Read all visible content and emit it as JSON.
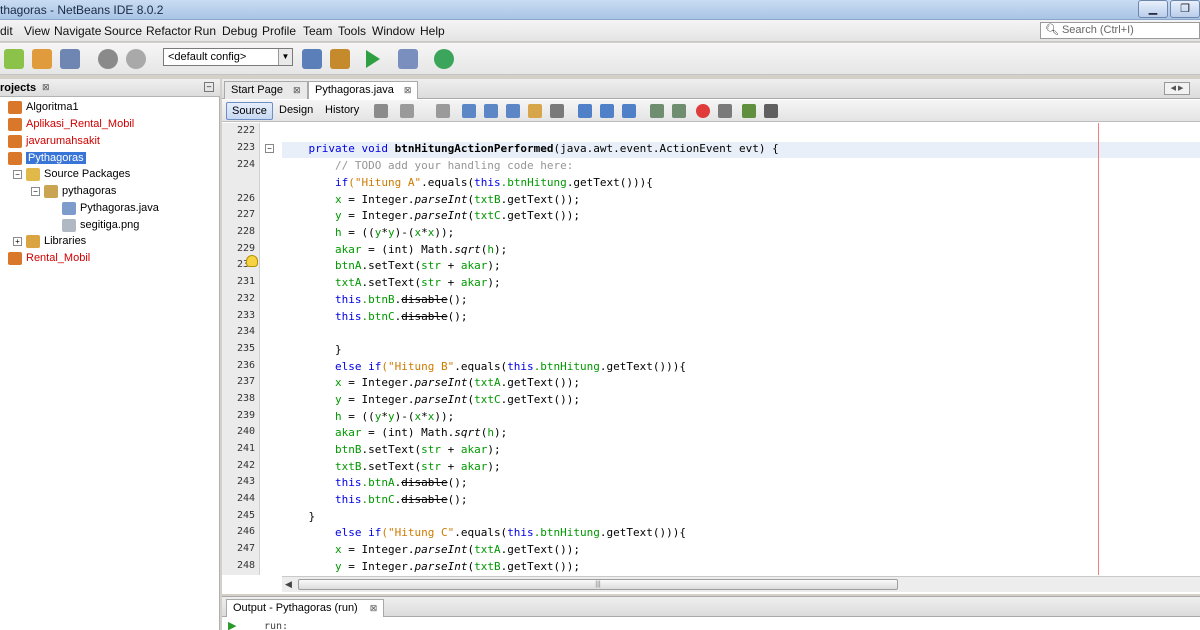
{
  "window": {
    "title": "thagoras - NetBeans IDE 8.0.2",
    "min_glyph": "▁",
    "max_glyph": "❐"
  },
  "menu": [
    "dit",
    "View",
    "Navigate",
    "Source",
    "Refactor",
    "Run",
    "Debug",
    "Profile",
    "Team",
    "Tools",
    "Window",
    "Help"
  ],
  "search": {
    "placeholder": "Search (Ctrl+I)",
    "icon": "magnifier-icon"
  },
  "toolbar": {
    "config": "<default config>",
    "config_arrow": "▼"
  },
  "projects": {
    "title": "rojects",
    "close_glyph": "⊠",
    "minimize_glyph": "–",
    "items": [
      {
        "label": "Algoritma1",
        "color": "normal"
      },
      {
        "label": "Aplikasi_Rental_Mobil",
        "color": "red"
      },
      {
        "label": "javarumahsakit",
        "color": "red"
      },
      {
        "label": "Pythagoras",
        "color": "selected"
      },
      {
        "label": "Source Packages",
        "color": "normal"
      },
      {
        "label": "pythagoras",
        "color": "normal"
      },
      {
        "label": "Pythagoras.java",
        "color": "normal"
      },
      {
        "label": "segitiga.png",
        "color": "normal"
      },
      {
        "label": "Libraries",
        "color": "normal"
      },
      {
        "label": "Rental_Mobil",
        "color": "red"
      }
    ]
  },
  "editor": {
    "tabs": [
      {
        "label": "Start Page",
        "close": "⊠"
      },
      {
        "label": "Pythagoras.java",
        "close": "⊠"
      }
    ],
    "nav_arrows": "◀ ▶",
    "views": [
      "Source",
      "Design",
      "History"
    ],
    "line_numbers": [
      "222",
      "223",
      "224",
      "",
      "226",
      "227",
      "228",
      "229",
      "230",
      "231",
      "232",
      "233",
      "234",
      "235",
      "236",
      "237",
      "238",
      "239",
      "240",
      "241",
      "242",
      "243",
      "244",
      "245",
      "246",
      "247",
      "248"
    ],
    "fold_glyph": "−",
    "code": {
      "l223": {
        "a": "    ",
        "kw1": "private void ",
        "name": "btnHitungActionPerformed",
        "rest": "(java.awt.event.ActionEvent evt) {"
      },
      "l224": {
        "cm": "        // TODO add your handling code here:"
      },
      "l225": {
        "kw": "        if",
        "str": "(\"Hitung A\"",
        "rest": ".equals(",
        "kw2": "this",
        "field": ".btnHitung",
        "tail": ".getText())){"
      },
      "l226": {
        "field": "        x",
        "a": " = Integer.",
        "it": "parseInt",
        "b": "(",
        "f2": "txtB",
        "c": ".getText());"
      },
      "l227": {
        "field": "        y",
        "a": " = Integer.",
        "it": "parseInt",
        "b": "(",
        "f2": "txtC",
        "c": ".getText());"
      },
      "l228": {
        "field": "        h",
        "a": " = ((",
        "f2": "y",
        "b": "*",
        "f3": "y",
        "c": ")-(",
        "f4": "x",
        "d": "*",
        "f5": "x",
        "e": "));"
      },
      "l229": {
        "field": "        akar",
        "a": " = (int) Math.",
        "it": "sqrt",
        "b": "(",
        "f2": "h",
        "c": ");"
      },
      "l230": {
        "field": "        btnA",
        "a": ".setText(",
        "f2": "str",
        "b": " + ",
        "f3": "akar",
        "c": ");"
      },
      "l231": {
        "field": "        txtA",
        "a": ".setText(",
        "f2": "str",
        "b": " + ",
        "f3": "akar",
        "c": ");"
      },
      "l232": {
        "kw": "        this",
        "field": ".btnB",
        "a": ".",
        "strike": "disable",
        "b": "();"
      },
      "l233": {
        "kw": "        this",
        "field": ".btnC",
        "a": ".",
        "strike": "disable",
        "b": "();"
      },
      "l235": {
        "a": "        }"
      },
      "l236": {
        "kw": "        else if",
        "str": "(\"Hitung B\"",
        "rest": ".equals(",
        "kw2": "this",
        "field": ".btnHitung",
        "tail": ".getText())){"
      },
      "l237": {
        "field": "        x",
        "a": " = Integer.",
        "it": "parseInt",
        "b": "(",
        "f2": "txtA",
        "c": ".getText());"
      },
      "l238": {
        "field": "        y",
        "a": " = Integer.",
        "it": "parseInt",
        "b": "(",
        "f2": "txtC",
        "c": ".getText());"
      },
      "l239": {
        "field": "        h",
        "a": " = ((",
        "f2": "y",
        "b": "*",
        "f3": "y",
        "c": ")-(",
        "f4": "x",
        "d": "*",
        "f5": "x",
        "e": "));"
      },
      "l240": {
        "field": "        akar",
        "a": " = (int) Math.",
        "it": "sqrt",
        "b": "(",
        "f2": "h",
        "c": ");"
      },
      "l241": {
        "field": "        btnB",
        "a": ".setText(",
        "f2": "str",
        "b": " + ",
        "f3": "akar",
        "c": ");"
      },
      "l242": {
        "field": "        txtB",
        "a": ".setText(",
        "f2": "str",
        "b": " + ",
        "f3": "akar",
        "c": ");"
      },
      "l243": {
        "kw": "        this",
        "field": ".btnA",
        "a": ".",
        "strike": "disable",
        "b": "();"
      },
      "l244": {
        "kw": "        this",
        "field": ".btnC",
        "a": ".",
        "strike": "disable",
        "b": "();"
      },
      "l245": {
        "a": "    }"
      },
      "l246": {
        "kw": "        else if",
        "str": "(\"Hitung C\"",
        "rest": ".equals(",
        "kw2": "this",
        "field": ".btnHitung",
        "tail": ".getText())){"
      },
      "l247": {
        "field": "        x",
        "a": " = Integer.",
        "it": "parseInt",
        "b": "(",
        "f2": "txtA",
        "c": ".getText());"
      },
      "l248": {
        "field": "        y",
        "a": " = Integer.",
        "it": "parseInt",
        "b": "(",
        "f2": "txtB",
        "c": ".getText());"
      }
    },
    "scroll_left": "◀",
    "scroll_grip": "|||"
  },
  "output": {
    "tab": "Output - Pythagoras (run)",
    "close": "⊠",
    "run": "run:",
    "play_glyph": "▶"
  },
  "colors": {
    "keyword": "#0000e6",
    "string": "#ce7b00",
    "field": "#009900",
    "comment": "#969696",
    "selection": "#3875d7"
  }
}
